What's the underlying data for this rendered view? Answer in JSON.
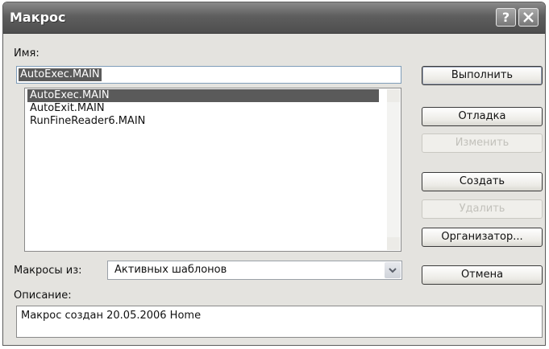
{
  "window": {
    "title": "Макрос",
    "help_label": "?"
  },
  "name_field": {
    "label": "Имя:",
    "value": "AutoExec.MAIN"
  },
  "macro_list": {
    "items": [
      "AutoExec.MAIN",
      "AutoExit.MAIN",
      "RunFineReader6.MAIN"
    ],
    "selected_index": 0
  },
  "buttons": {
    "run": "Выполнить",
    "debug": "Отладка",
    "edit": "Изменить",
    "create": "Создать",
    "delete": "Удалить",
    "organizer": "Организатор...",
    "cancel": "Отмена"
  },
  "macros_from": {
    "label": "Макросы из:",
    "value": "Активных шаблонов"
  },
  "description": {
    "label": "Описание:",
    "value": "Макрос создан 20.05.2006 Home"
  },
  "colors": {
    "selection": "#5a5a5a",
    "dialog_bg": "#e4e3df",
    "titlebar": "#5e5e5e"
  }
}
